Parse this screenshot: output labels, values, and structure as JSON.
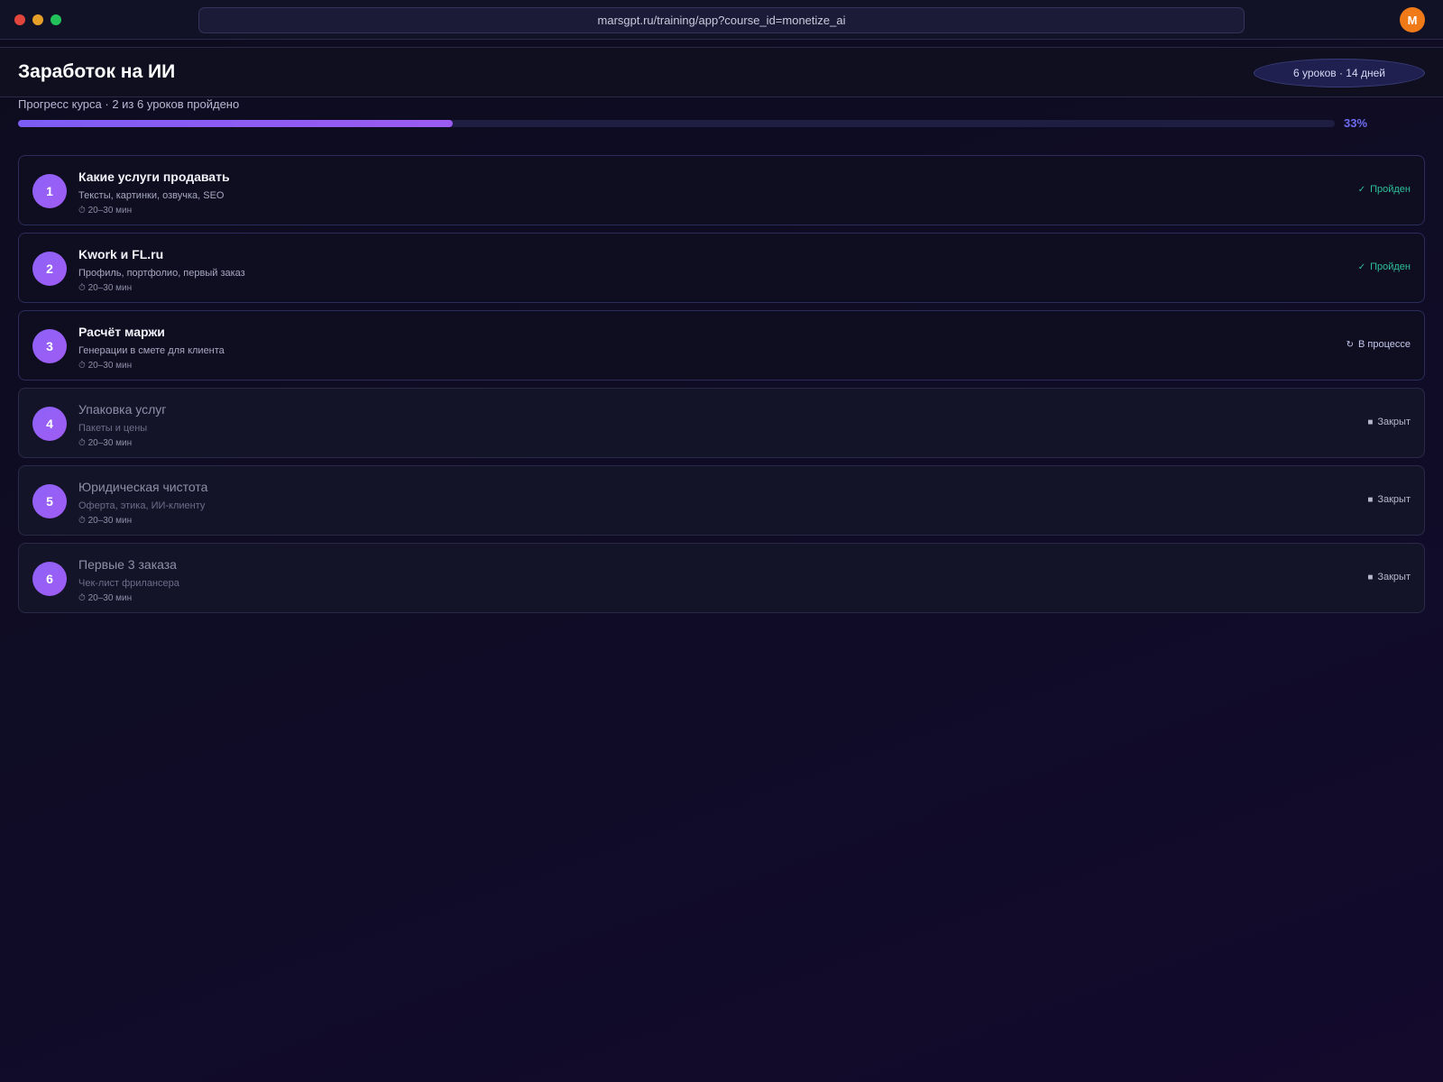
{
  "browser": {
    "url": "marsgpt.ru/training/app?course_id=monetize_ai",
    "avatar_letter": "M"
  },
  "course": {
    "title": "Заработок на ИИ",
    "meta": "6 уроков · 14 дней",
    "progress_label": "Прогресс курса · 2 из 6 уроков пройдено",
    "progress_percent_text": "33%",
    "progress_value": 0.33
  },
  "lessons": [
    {
      "num": "1",
      "title": "Какие услуги продавать",
      "subtitle": "Тексты, картинки, озвучка, SEO",
      "duration": "20–30 мин",
      "status": "Пройден",
      "status_icon": "check-icon",
      "state": "done"
    },
    {
      "num": "2",
      "title": "Kwork и FL.ru",
      "subtitle": "Профиль, портфолио, первый заказ",
      "duration": "20–30 мин",
      "status": "Пройден",
      "status_icon": "check-icon",
      "state": "done"
    },
    {
      "num": "3",
      "title": "Расчёт маржи",
      "subtitle": "Генерации в смете для клиента",
      "duration": "20–30 мин",
      "status": "В процессе",
      "status_icon": "refresh-icon",
      "state": "progress"
    },
    {
      "num": "4",
      "title": "Упаковка услуг",
      "subtitle": "Пакеты и цены",
      "duration": "20–30 мин",
      "status": "Закрыт",
      "status_icon": "lock-icon",
      "state": "locked"
    },
    {
      "num": "5",
      "title": "Юридическая чистота",
      "subtitle": "Оферта, этика, ИИ-клиенту",
      "duration": "20–30 мин",
      "status": "Закрыт",
      "status_icon": "lock-icon",
      "state": "locked"
    },
    {
      "num": "6",
      "title": "Первые 3 заказа",
      "subtitle": "Чек-лист фрилансера",
      "duration": "20–30 мин",
      "status": "Закрыт",
      "status_icon": "lock-icon",
      "state": "locked"
    }
  ]
}
